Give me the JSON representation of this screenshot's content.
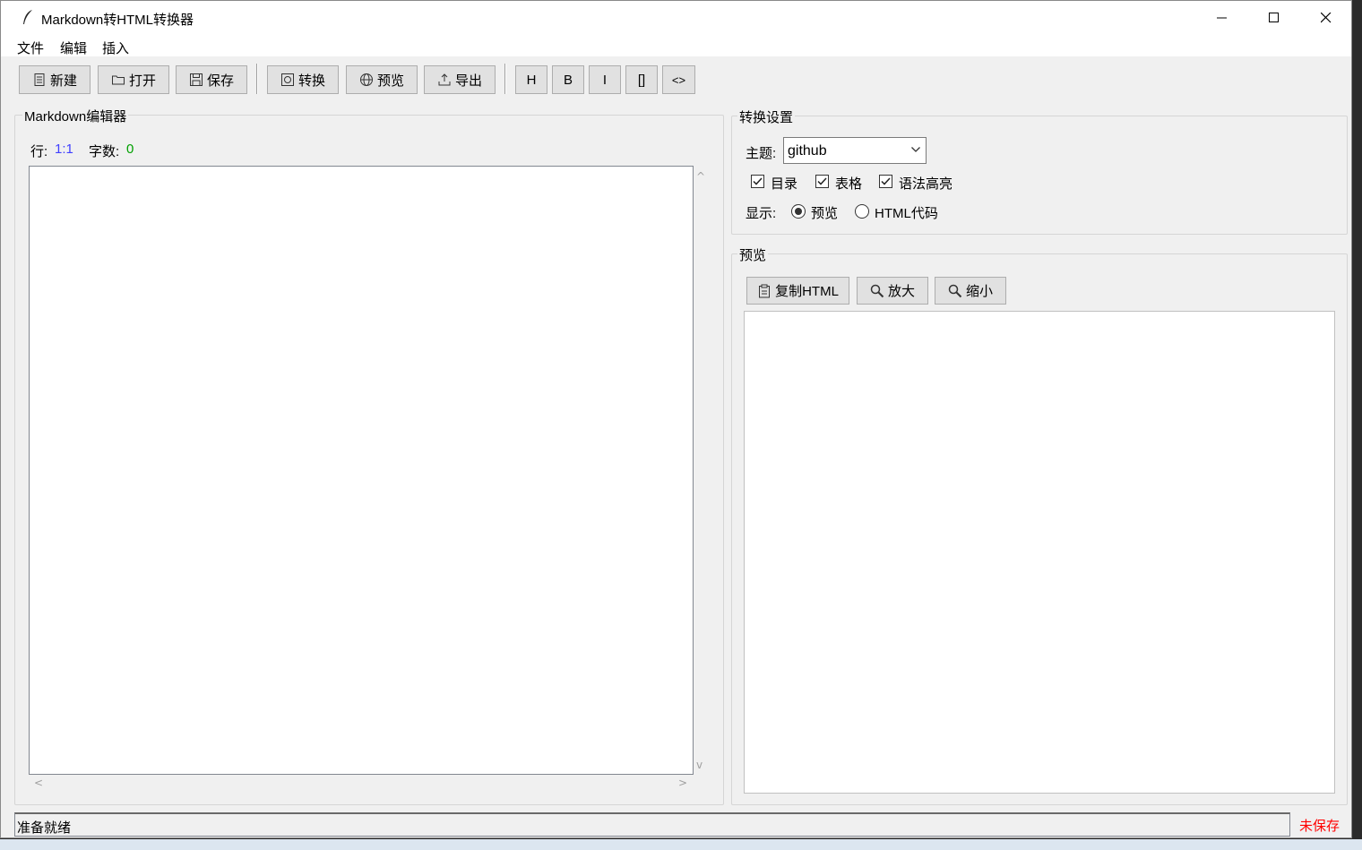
{
  "window": {
    "title": "Markdown转HTML转换器"
  },
  "menu": [
    "文件",
    "编辑",
    "插入"
  ],
  "toolbar": {
    "new": "新建",
    "open": "打开",
    "save": "保存",
    "convert": "转换",
    "preview": "预览",
    "export": "导出",
    "h": "H",
    "b": "B",
    "i": "I",
    "brackets": "[]",
    "code": "<>"
  },
  "editor": {
    "title": "Markdown编辑器",
    "line_label": "行:",
    "line_value": "1:1",
    "chars_label": "字数:",
    "chars_value": "0",
    "content": ""
  },
  "settings": {
    "title": "转换设置",
    "theme_label": "主题:",
    "theme_value": "github",
    "toc_label": "目录",
    "toc_checked": true,
    "table_label": "表格",
    "table_checked": true,
    "highlight_label": "语法高亮",
    "highlight_checked": true,
    "display_label": "显示:",
    "display_preview": "预览",
    "display_html": "HTML代码",
    "display_selected": "预览"
  },
  "preview": {
    "title": "预览",
    "copy_html": "复制HTML",
    "zoom_in": "放大",
    "zoom_out": "缩小"
  },
  "status": {
    "text": "准备就绪",
    "unsaved": "未保存"
  },
  "colors": {
    "line_value": "#4040ff",
    "chars_value": "#00a000",
    "unsaved": "#ff0000"
  }
}
